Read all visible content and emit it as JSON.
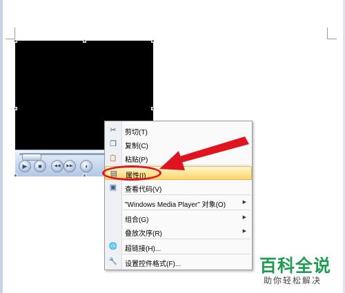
{
  "context_menu": {
    "items": [
      {
        "label": "剪切(T)",
        "icon": "scissors-icon",
        "glyph": "✂"
      },
      {
        "label": "复制(C)",
        "icon": "copy-icon",
        "glyph": "❐"
      },
      {
        "label": "粘贴(P)",
        "icon": "paste-icon",
        "glyph": "📋"
      },
      {
        "label": "属性(I)",
        "icon": "properties-icon",
        "glyph": "▤",
        "highlighted": true
      },
      {
        "label": "查看代码(V)",
        "icon": "view-code-icon",
        "glyph": "▣"
      },
      {
        "label": "\"Windows Media Player\" 对象(O)",
        "submenu": true
      },
      {
        "label": "组合(G)",
        "submenu": true
      },
      {
        "label": "叠放次序(R)",
        "submenu": true
      },
      {
        "label": "超链接(H)...",
        "icon": "hyperlink-icon",
        "glyph": "🌐"
      },
      {
        "label": "设置控件格式(F)...",
        "icon": "format-control-icon",
        "glyph": "🔧"
      }
    ]
  },
  "media_player": {
    "controls": [
      {
        "name": "play-icon",
        "glyph": "▶"
      },
      {
        "name": "stop-icon",
        "glyph": "■"
      },
      {
        "name": "previous-icon",
        "glyph": "◀◀"
      },
      {
        "name": "next-icon",
        "glyph": "▶▶"
      },
      {
        "name": "volume-icon",
        "glyph": "◖"
      }
    ]
  },
  "annotation": {
    "color": "#e0141e"
  },
  "watermark": {
    "title": "百科全说",
    "subtitle": "助你轻松解决"
  }
}
